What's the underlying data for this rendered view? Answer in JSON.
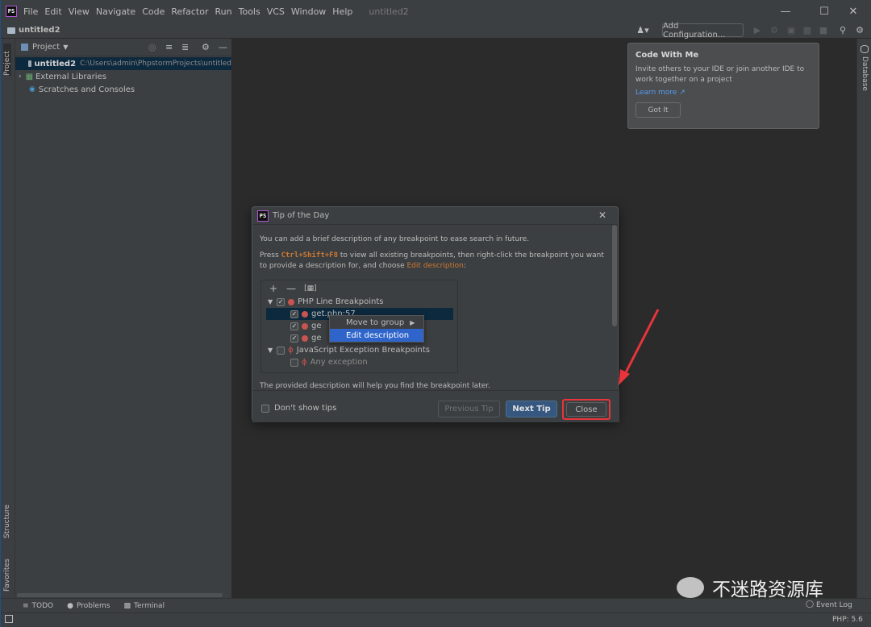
{
  "window": {
    "title": "untitled2",
    "menu": [
      "File",
      "Edit",
      "View",
      "Navigate",
      "Code",
      "Refactor",
      "Run",
      "Tools",
      "VCS",
      "Window",
      "Help"
    ],
    "logo": "PS"
  },
  "navbar": {
    "project": "untitled2",
    "add_configuration": "Add Configuration..."
  },
  "left_strip": {
    "project_tab": "Project",
    "structure_tab": "Structure",
    "favorites_tab": "Favorites"
  },
  "right_strip": {
    "database_tab": "Database"
  },
  "project_panel": {
    "header": "Project",
    "items": [
      {
        "name": "untitled2",
        "path": "C:\\Users\\admin\\PhpstormProjects\\untitled"
      },
      {
        "name": "External Libraries"
      },
      {
        "name": "Scratches and Consoles"
      }
    ]
  },
  "code_with_me": {
    "title": "Code With Me",
    "text": "Invite others to your IDE or join another IDE to work together on a project",
    "link": "Learn more ↗",
    "button": "Got It"
  },
  "tip_dialog": {
    "title": "Tip of the Day",
    "line1": "You can add a brief description of any breakpoint to ease search in future.",
    "line2_a": "Press ",
    "line2_kbd": "Ctrl+Shift+F8",
    "line2_b": " to view all existing breakpoints, then right-click the breakpoint you want to provide a description for, and choose ",
    "line2_action": "Edit description",
    "line2_end": ":",
    "tree": {
      "group1": "PHP Line Breakpoints",
      "bp1": "get.php:57",
      "bp2": "ge",
      "bp3": "ge",
      "group2": "JavaScript Exception Breakpoints",
      "any": "Any exception"
    },
    "context_menu": {
      "move": "Move to group",
      "edit": "Edit description"
    },
    "footer_text": "The provided description will help you find the breakpoint later.",
    "dont_show": "Don't show tips",
    "prev": "Previous Tip",
    "next": "Next Tip",
    "close": "Close"
  },
  "bottom_bar": {
    "todo": "TODO",
    "problems": "Problems",
    "terminal": "Terminal",
    "event_log": "Event Log"
  },
  "status": {
    "php": "PHP: 5.6"
  },
  "watermark": "不迷路资源库",
  "colors": {
    "accent": "#365880",
    "highlight": "#2f65ca",
    "red_annotation": "#e8343a"
  }
}
